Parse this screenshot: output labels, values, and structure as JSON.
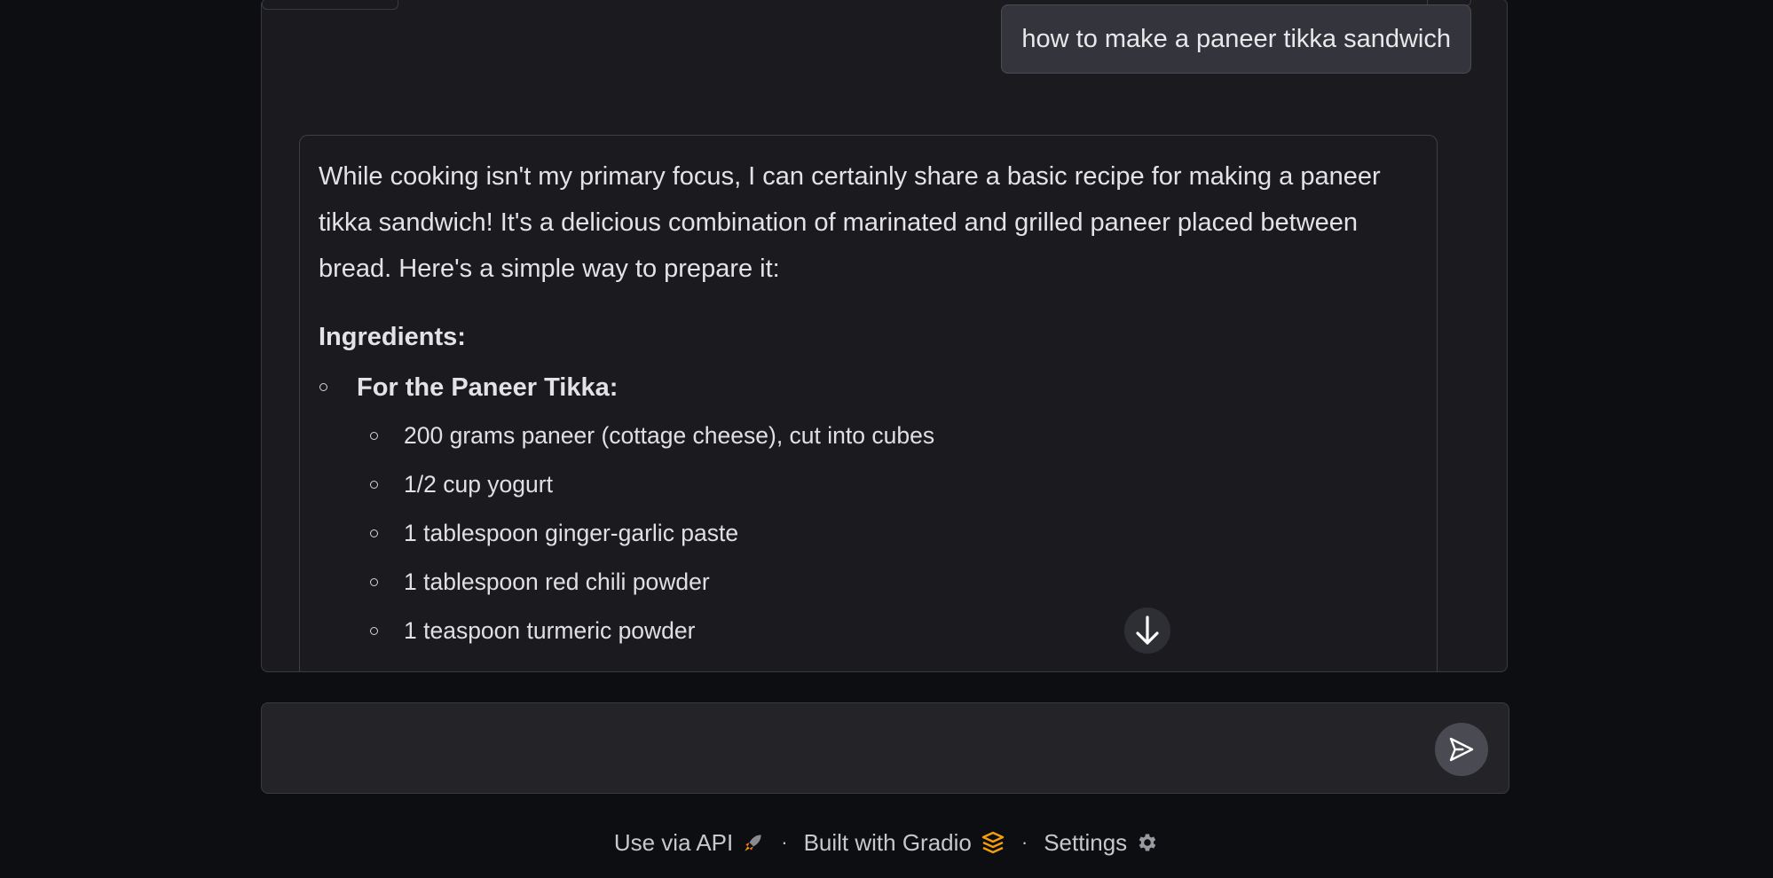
{
  "chat": {
    "user_message": "how to make a paneer tikka sandwich",
    "bot_intro": "While cooking isn't my primary focus, I can certainly share a basic recipe for making a paneer tikka sandwich! It's a delicious combination of marinated and grilled paneer placed between bread. Here's a simple way to prepare it:",
    "ingredients_heading": "Ingredients:",
    "sections": [
      {
        "label": "For the Paneer Tikka:",
        "items": [
          "200 grams paneer (cottage cheese), cut into cubes",
          "1/2 cup yogurt",
          "1 tablespoon ginger-garlic paste",
          "1 tablespoon red chili powder",
          "1 teaspoon turmeric powder"
        ]
      }
    ],
    "scroll_down_icon": "arrow-down-icon"
  },
  "input": {
    "placeholder": "",
    "value": "",
    "send_icon": "send-icon"
  },
  "footer": {
    "api_label": "Use via API",
    "api_icon": "rocket-icon",
    "separator": "·",
    "gradio_label": "Built with Gradio",
    "gradio_icon": "gradio-logo-icon",
    "settings_label": "Settings",
    "settings_icon": "gear-icon"
  },
  "colors": {
    "background": "#0d0e12",
    "panel": "#1b1b1f",
    "user_bubble": "#34353c",
    "accent_orange": "#f59e0b"
  }
}
